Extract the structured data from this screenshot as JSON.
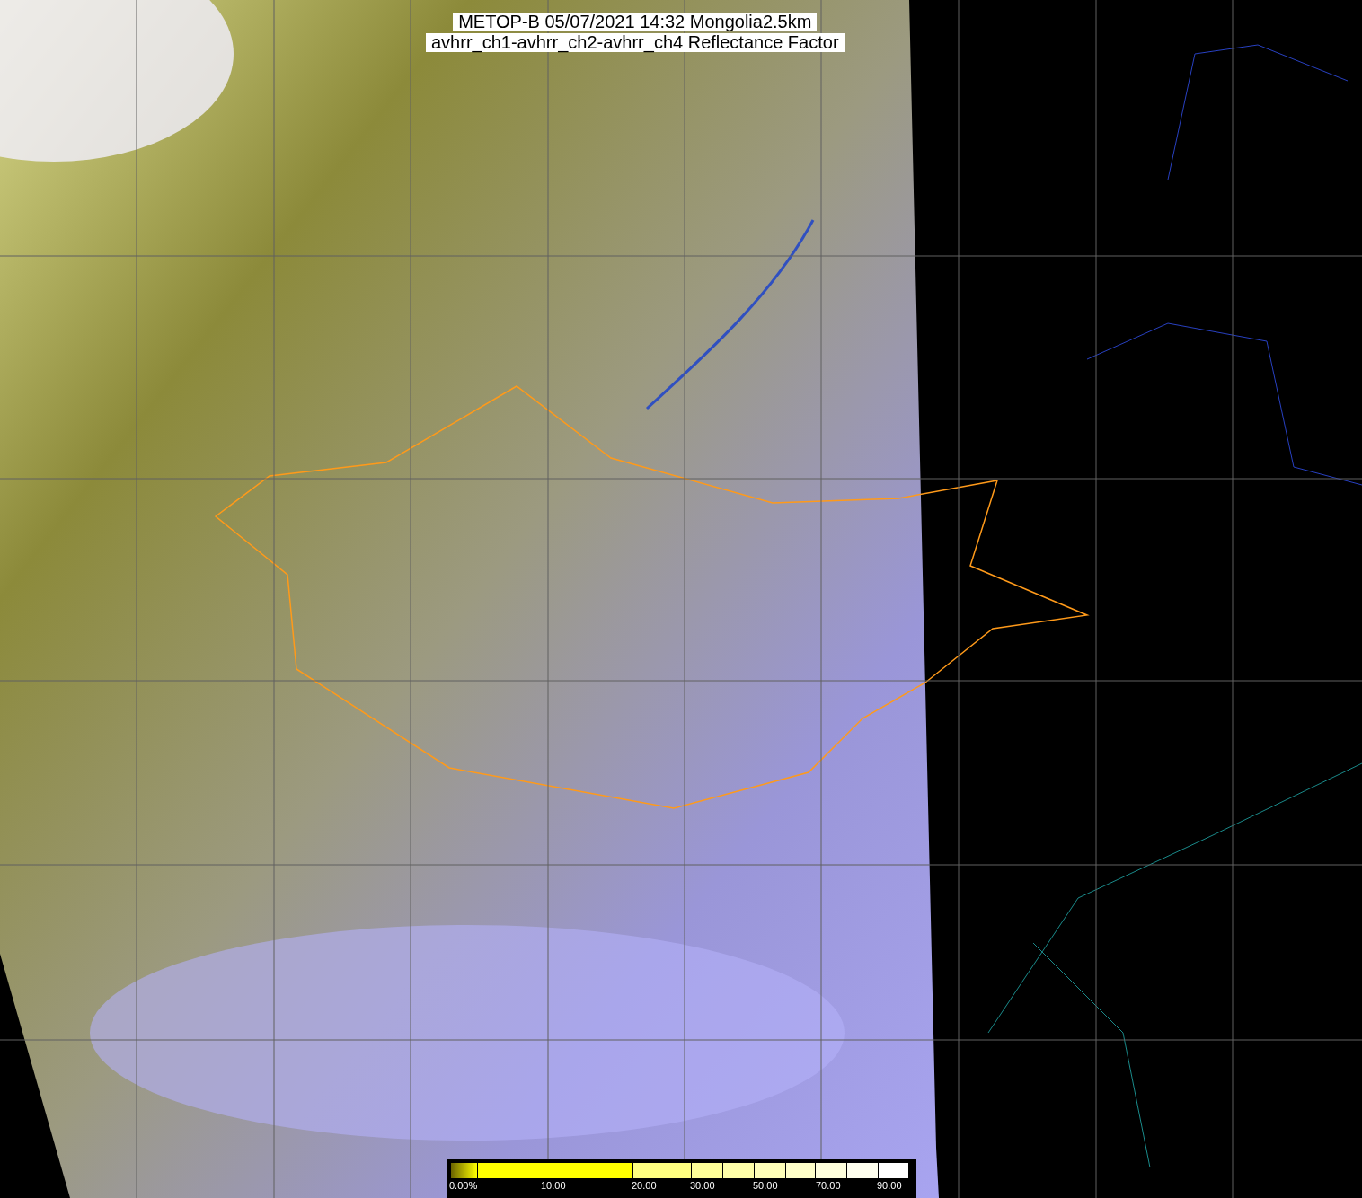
{
  "title": {
    "lines": [
      "METOP-B 05/07/2021 14:32 Mongolia2.5km",
      "avhrr_ch1-avhrr_ch2-avhrr_ch4 Reflectance Factor"
    ]
  },
  "colorbar": {
    "labels": [
      "0.00%",
      "10.00",
      "20.00",
      "30.00",
      "50.00",
      "70.00",
      "90.00"
    ]
  }
}
